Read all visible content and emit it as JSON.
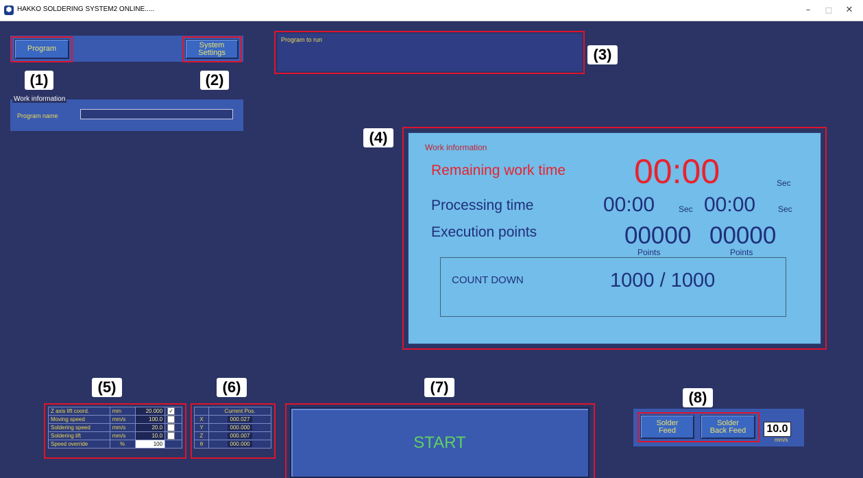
{
  "window": {
    "title": "HAKKO SOLDERING SYSTEM2 ONLINE.....",
    "minimize": "–",
    "maximize": "□",
    "close": "✕"
  },
  "callouts": {
    "c1": "(1)",
    "c2": "(2)",
    "c3": "(3)",
    "c4": "(4)",
    "c5": "(5)",
    "c6": "(6)",
    "c7": "(7)",
    "c8": "(8)"
  },
  "top": {
    "program_btn": "Program",
    "system_btn_line1": "System",
    "system_btn_line2": "Settings",
    "program_to_run": "Program to run"
  },
  "work_info_small": {
    "legend": "Work information",
    "program_name_label": "Program name",
    "program_name_value": ""
  },
  "work_info": {
    "heading": "Work information",
    "remaining_label": "Remaining work time",
    "remaining_value": "00:00",
    "remaining_unit": "Sec",
    "processing_label": "Processing time",
    "processing_value1": "00:00",
    "processing_unit1": "Sec",
    "processing_value2": "00:00",
    "processing_unit2": "Sec",
    "execution_label": "Execution points",
    "execution_value1": "00000",
    "execution_unit1": "Points",
    "execution_value2": "00000",
    "execution_unit2": "Points",
    "countdown_label": "COUNT DOWN",
    "countdown_value": "1000 / 1000"
  },
  "params": {
    "rows": [
      {
        "label": "Z axis lift coord.",
        "unit": "mm",
        "value": "20.000",
        "checked": true
      },
      {
        "label": "Moving speed",
        "unit": "mm/s",
        "value": "100.0",
        "checked": false
      },
      {
        "label": "Soldering speed",
        "unit": "mm/s",
        "value": "20.0",
        "checked": false
      },
      {
        "label": "Soldering lift",
        "unit": "mm/s",
        "value": "10.0",
        "checked": false
      },
      {
        "label": "Speed override",
        "unit": "%",
        "value": "100",
        "checked": null
      }
    ]
  },
  "position": {
    "header": "Current Pos.",
    "rows": [
      {
        "axis": "X",
        "value": "000.027"
      },
      {
        "axis": "Y",
        "value": "000.000"
      },
      {
        "axis": "Z",
        "value": "000.007"
      },
      {
        "axis": "θ",
        "value": "000.000"
      }
    ]
  },
  "start_label": "START",
  "solder": {
    "feed_line1": "Solder",
    "feed_line2": "Feed",
    "back_line1": "Solder",
    "back_line2": "Back Feed",
    "speed_value": "10.0",
    "speed_unit": "mm/s"
  },
  "colors": {
    "background": "#2b3465",
    "callout_border": "#e0142c",
    "button_text": "#e8e070",
    "start_text": "#5fd060",
    "remaining_red": "#e8232e"
  }
}
